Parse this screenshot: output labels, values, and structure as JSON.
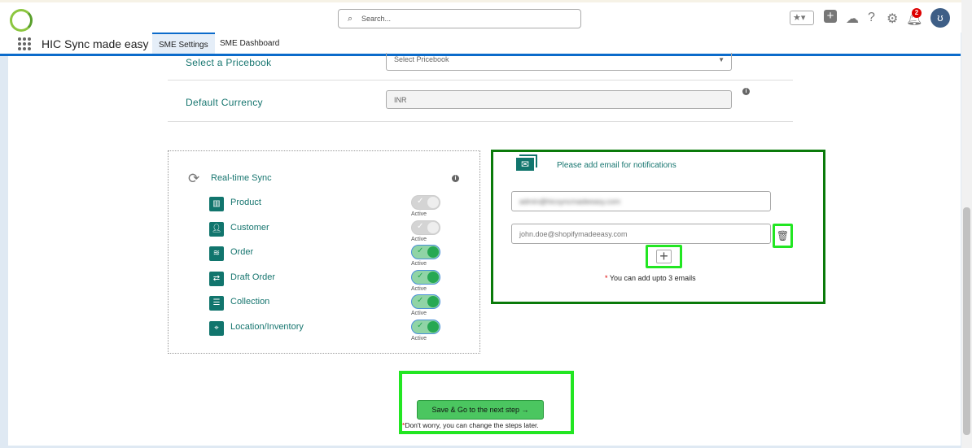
{
  "header": {
    "search_placeholder": "Search...",
    "notification_count": "2"
  },
  "nav": {
    "app_title": "HIC Sync made easy",
    "tabs": [
      {
        "label": "SME Settings",
        "active": true
      },
      {
        "label": "SME Dashboard",
        "active": false
      }
    ]
  },
  "settings": {
    "pricebook_label": "Select a Pricebook",
    "pricebook_value": "Select Pricebook",
    "currency_label": "Default Currency",
    "currency_value": "INR"
  },
  "sync": {
    "title": "Real-time Sync",
    "items": [
      {
        "label": "Product",
        "status": "Active",
        "enabled": false
      },
      {
        "label": "Customer",
        "status": "Active",
        "enabled": false
      },
      {
        "label": "Order",
        "status": "Active",
        "enabled": true
      },
      {
        "label": "Draft Order",
        "status": "Active",
        "enabled": true
      },
      {
        "label": "Collection",
        "status": "Active",
        "enabled": true
      },
      {
        "label": "Location/Inventory",
        "status": "Active",
        "enabled": true
      }
    ]
  },
  "email": {
    "title": "Please add email for notifications",
    "email1": "admin@hicsyncmadeeasy.com",
    "email2_placeholder": "john.doe@shopifymadeeasy.com",
    "note": "You can add upto 3 emails",
    "asterisk": "*"
  },
  "footer": {
    "save_label": "Save & Go to the next step",
    "note": "Don't worry, you can change the steps later."
  },
  "colors": {
    "accent": "#16756f",
    "toggle_on": "#27a853",
    "highlight": "#22e622",
    "brand_blue": "#0b6bcb"
  }
}
